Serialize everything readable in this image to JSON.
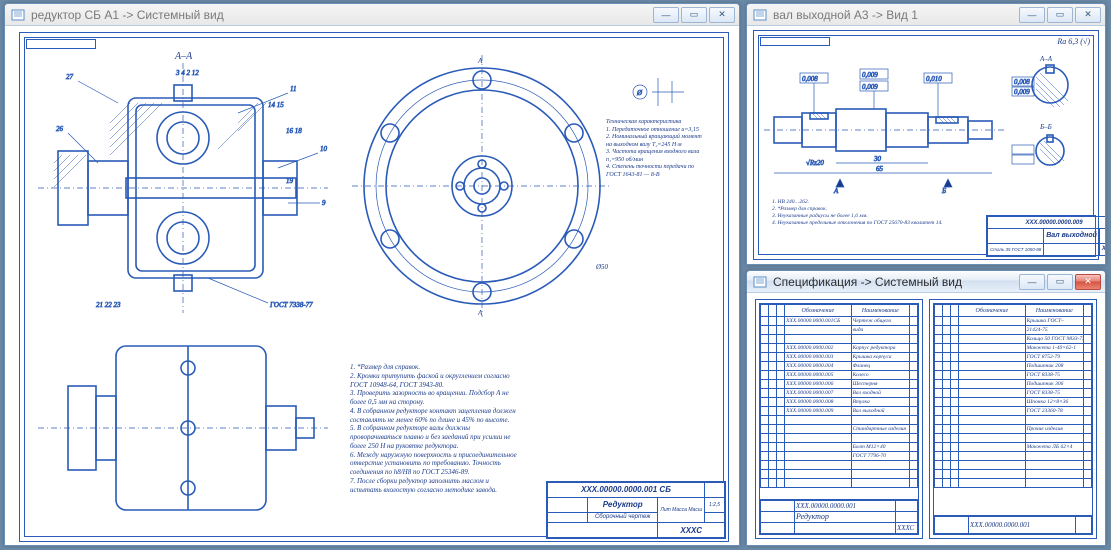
{
  "windows": {
    "w1": {
      "title": "редуктор СБ А1 -> Системный вид",
      "drawing_number": "ХХХ.00000.0000.001 СБ",
      "product_name": "Редуктор",
      "drawing_type": "Сборочный чертеж",
      "scale_label": "ХХХС",
      "notes_right_top": "А",
      "section_label": "А–А",
      "geom_symbol": "Ø",
      "tech_params": "Техническая характеристика\n1. Передаточное отношение u=3,15\n2. Номинальный вращающий момент на выходном валу T₂=245 Н·м\n3. Частота вращения входного вала n₁=950 об/мин\n4. Степень точности передачи по ГОСТ 1643-81 — 8-В",
      "notes_bottom": "1. *Размер для справок.\n2. Кромки притупить фаской и округлением согласно ГОСТ 10948-64, ГОСТ 3943-80.\n3. Проверить зазорность во вращении. Подсбор А не более 0,5 мм на сторону.\n4. В собранном редукторе контакт зацепления должен составлять не менее 60% по длине и 45% по высоте.\n5. В собранном редукторе валы должны проворачиваться плавно и без заеданий при усилии не более 250 Н на рукоятке редуктора.\n6. Между наружную поверхность и присоединительное отверстие установить по требованию. Точность соединения по h8/H8 по ГОСТ 25346-89.\n7. После сборки редуктор заполнить маслом и испытать вхолостую согласно методике завода."
    },
    "w2": {
      "title": "вал выходной А3 -> Вид 1",
      "drawing_number": "ХХХ.00000.0000.009",
      "product_name": "Вал выходной",
      "material": "Сталь 35 ГОСТ 1050-88",
      "scale_label": "ХХХС",
      "surface_mark": "Ra 6,3 (√)",
      "section_a": "А–А",
      "section_b": "Б–Б",
      "tol_boxes": [
        "0,008",
        "0,009",
        "0,009",
        "0,010",
        "0,008",
        "0,009"
      ],
      "notes": "1. НВ 240…262.\n2. *Размер для справок.\n3. Неуказанные радиусы не более 1,6 мм.\n4. Неуказанные предельные отклонения по ГОСТ 25670-83 квалитет 14."
    },
    "w3": {
      "title": "Спецификация -> Системный вид",
      "header_cols": [
        "Обозначение",
        "Наименование",
        "Обозначение",
        "Наименование"
      ],
      "product_name": "Редуктор",
      "drawing_number_left": "ХХХ.00000.0000.001",
      "drawing_number_right": "ХХХ.00000.0000.001",
      "scale_label": "ХХХС",
      "rows_left": [
        [
          "ХХХ.00000.0000.001СБ",
          "Чертеж общего"
        ],
        [
          "",
          "вида"
        ],
        [
          "",
          ""
        ],
        [
          "ХХХ.00000.0000.002",
          "Корпус редуктора"
        ],
        [
          "ХХХ.00000.0000.003",
          "Крышка корпуса"
        ],
        [
          "ХХХ.00000.0000.004",
          "Фланец"
        ],
        [
          "ХХХ.00000.0000.005",
          "Колесо"
        ],
        [
          "ХХХ.00000.0000.006",
          "Шестерня"
        ],
        [
          "ХХХ.00000.0000.007",
          "Вал входной"
        ],
        [
          "ХХХ.00000.0000.008",
          "Втулка"
        ],
        [
          "ХХХ.00000.0000.009",
          "Вал выходной"
        ],
        [
          "",
          ""
        ],
        [
          "",
          "Стандартные изделия"
        ],
        [
          "",
          ""
        ],
        [
          "",
          "Болт М12×40"
        ],
        [
          "",
          "ГОСТ 7796-70"
        ]
      ],
      "rows_right": [
        [
          "",
          "Крышка ГОСТ–"
        ],
        [
          "",
          "21424-75"
        ],
        [
          "",
          "Кольцо 50 ГОСТ 9833-73"
        ],
        [
          "",
          "Манжета 1-40×62-1"
        ],
        [
          "",
          "ГОСТ 8752-79"
        ],
        [
          "",
          "Подшипник 208"
        ],
        [
          "",
          "ГОСТ 8338-75"
        ],
        [
          "",
          "Подшипник 306"
        ],
        [
          "",
          "ГОСТ 8338-75"
        ],
        [
          "",
          "Шпонка 12×8×36"
        ],
        [
          "",
          "ГОСТ 23360-78"
        ],
        [
          "",
          ""
        ],
        [
          "",
          "Прочие изделия"
        ],
        [
          "",
          ""
        ],
        [
          "",
          "Манжета ЛБ 62×4"
        ],
        [
          "",
          ""
        ]
      ]
    }
  },
  "icons": {
    "minimize": "—",
    "maximize": "▭",
    "close": "✕"
  }
}
